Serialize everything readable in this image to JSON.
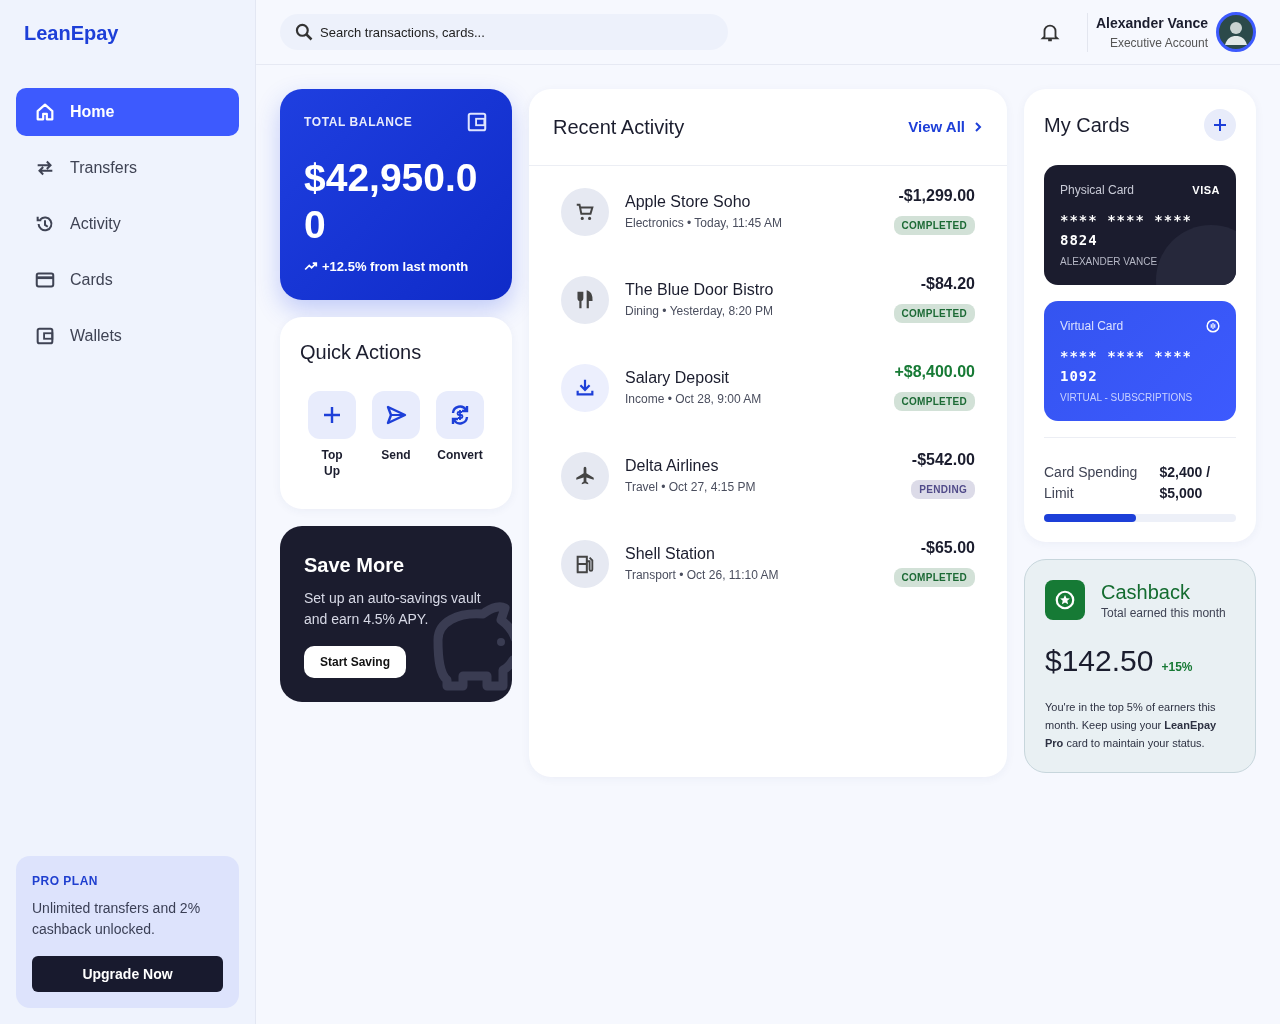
{
  "brand": "LeanEpay",
  "sidebar": {
    "items": [
      {
        "label": "Home",
        "selected": true
      },
      {
        "label": "Transfers",
        "selected": false
      },
      {
        "label": "Activity",
        "selected": false
      },
      {
        "label": "Cards",
        "selected": false
      },
      {
        "label": "Wallets",
        "selected": false
      }
    ]
  },
  "pro_plan": {
    "title": "PRO PLAN",
    "text": "Unlimited transfers and 2% cashback unlocked.",
    "button": "Upgrade Now"
  },
  "search": {
    "placeholder": "Search transactions, cards..."
  },
  "user": {
    "name": "Alexander Vance",
    "role": "Executive Account"
  },
  "balance": {
    "label": "TOTAL BALANCE",
    "amount": "$42,950.00",
    "change": "+12.5% from last month"
  },
  "quick_actions": {
    "title": "Quick Actions",
    "actions": [
      "Top Up",
      "Send",
      "Convert"
    ]
  },
  "save_more": {
    "title": "Save More",
    "text": "Set up an auto-savings vault and earn 4.5% APY.",
    "button": "Start Saving"
  },
  "activity": {
    "title": "Recent Activity",
    "view_all": "View All",
    "transactions": [
      {
        "name": "Apple Store Soho",
        "meta": "Electronics • Today, 11:45 AM",
        "amount": {
          "text": "-$1,299.00",
          "color": "#1b1d2e"
        },
        "status": {
          "text": "COMPLETED",
          "color": "#1c6a35"
        }
      },
      {
        "name": "The Blue Door Bistro",
        "meta": "Dining • Yesterday, 8:20 PM",
        "amount": {
          "text": "-$84.20",
          "color": "#1b1d2e"
        },
        "status": {
          "text": "COMPLETED",
          "color": "#1c6a35"
        }
      },
      {
        "name": "Salary Deposit",
        "meta": "Income • Oct 28, 9:00 AM",
        "amount": {
          "text": "+$8,400.00",
          "color": "#177a35"
        },
        "status": {
          "text": "COMPLETED",
          "color": "#1c6a35"
        }
      },
      {
        "name": "Delta Airlines",
        "meta": "Travel • Oct 27, 4:15 PM",
        "amount": {
          "text": "-$542.00",
          "color": "#1b1d2e"
        },
        "status": {
          "text": "PENDING",
          "color": "#514b8a"
        }
      },
      {
        "name": "Shell Station",
        "meta": "Transport • Oct 26, 11:10 AM",
        "amount": {
          "text": "-$65.00",
          "color": "#1b1d2e"
        },
        "status": {
          "text": "COMPLETED",
          "color": "#1c6a35"
        }
      }
    ]
  },
  "my_cards": {
    "title": "My Cards",
    "cards": [
      {
        "kind": "physical",
        "label": "Physical Card",
        "brand": "VISA",
        "number": "**** **** **** 8824",
        "holder": "ALEXANDER VANCE"
      },
      {
        "kind": "virtual",
        "label": "Virtual Card",
        "number": "**** **** **** 1092",
        "holder": "VIRTUAL - SUBSCRIPTIONS"
      }
    ],
    "spending": {
      "label": "Card Spending Limit",
      "value": "$2,400 / $5,000",
      "level": 0.48
    }
  },
  "cashback": {
    "title": "Cashback",
    "subtitle": "Total earned this month",
    "amount": "$142.50",
    "change": "+15%",
    "text": "You're in the top 5% of earners this month. Keep using your **LeanEpay Pro** card to maintain your status."
  }
}
